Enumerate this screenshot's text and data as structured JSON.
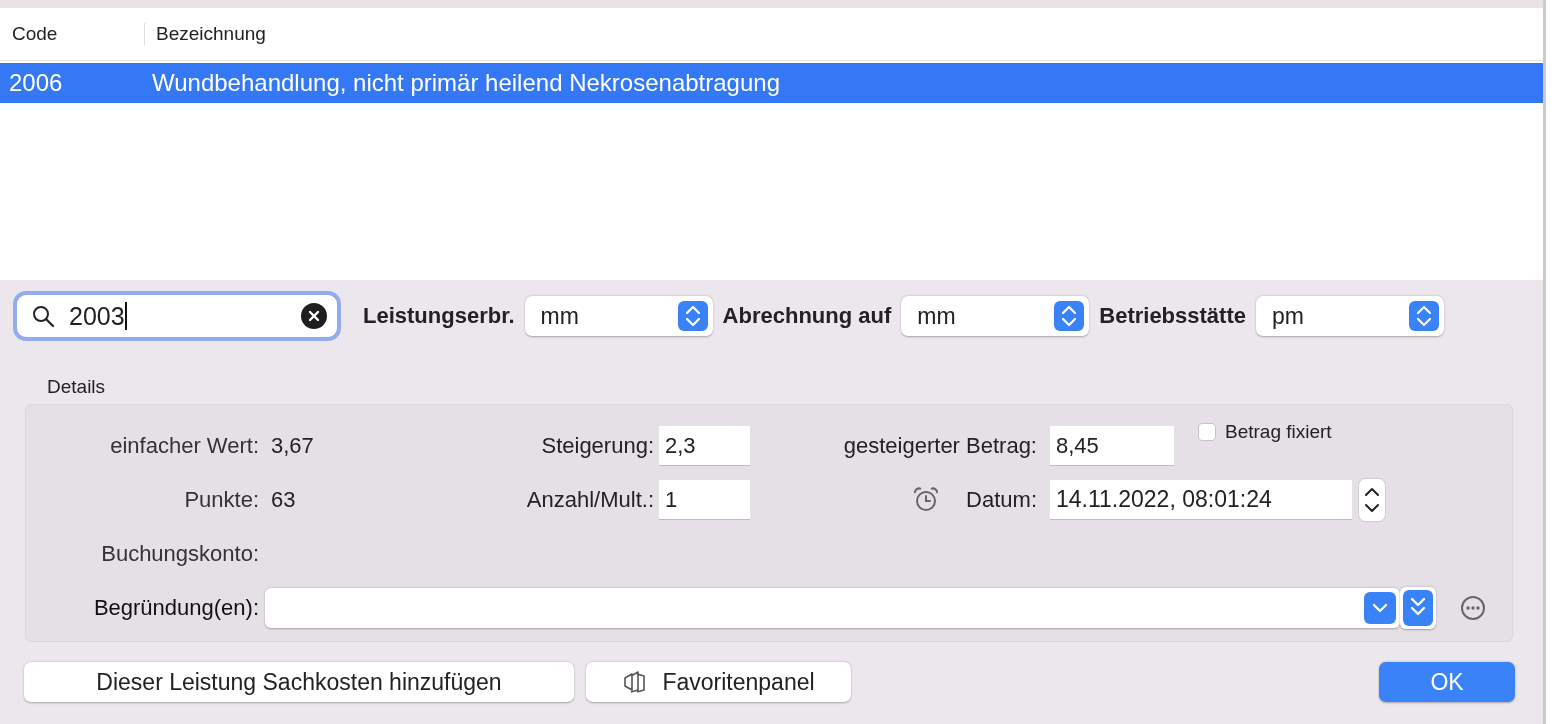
{
  "table": {
    "columns": [
      "Code",
      "Bezeichnung"
    ],
    "rows": [
      {
        "code": "2006",
        "description": "Wundbehandlung, nicht primär heilend Nekrosenabtragung",
        "selected": true
      }
    ]
  },
  "search": {
    "value": "2003"
  },
  "selectors": [
    {
      "label": "Leistungserbr.",
      "value": "mm"
    },
    {
      "label": "Abrechnung auf",
      "value": "mm"
    },
    {
      "label": "Betriebsstätte",
      "value": "pm"
    }
  ],
  "details": {
    "title": "Details",
    "einfacher_wert": {
      "label": "einfacher Wert:",
      "value": "3,67"
    },
    "punkte": {
      "label": "Punkte:",
      "value": "63"
    },
    "steigerung": {
      "label": "Steigerung:",
      "value": "2,3"
    },
    "anzahl": {
      "label": "Anzahl/Mult.:",
      "value": "1"
    },
    "gesteigerter_betrag": {
      "label": "gesteigerter Betrag:",
      "value": "8,45"
    },
    "betrag_fixiert": {
      "label": "Betrag fixiert",
      "checked": false
    },
    "datum": {
      "label": "Datum:",
      "value": "14.11.2022, 08:01:24"
    },
    "buchungskonto": {
      "label": "Buchungskonto:"
    },
    "begruendung": {
      "label": "Begründung(en):"
    }
  },
  "footer": {
    "buttons": [
      {
        "kind": "plain",
        "label": "Dieser Leistung Sachkosten hinzufügen"
      },
      {
        "kind": "icon",
        "label": "Favoritenpanel"
      },
      {
        "kind": "default",
        "label": "OK"
      }
    ]
  }
}
